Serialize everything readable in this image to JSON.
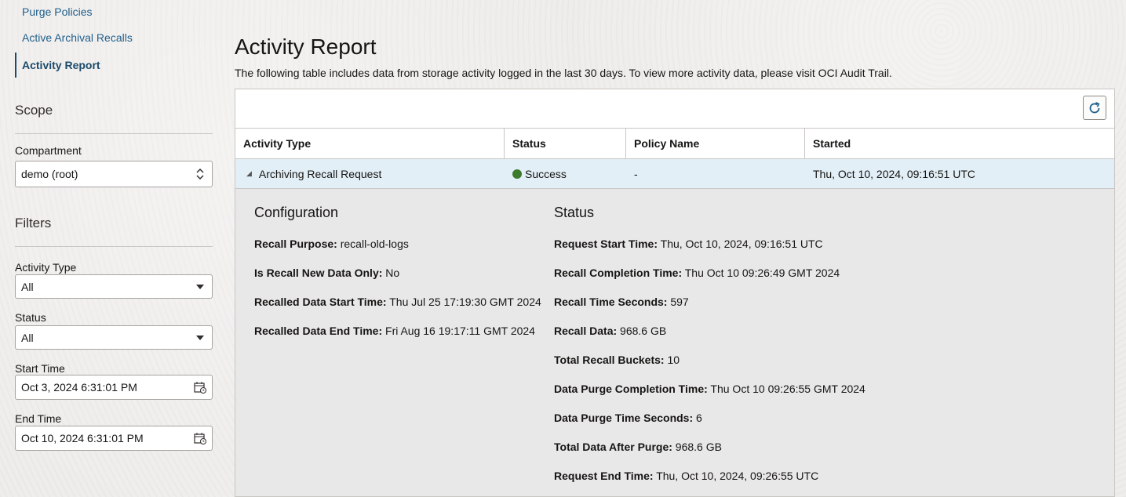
{
  "sidebar": {
    "nav": [
      {
        "label": "Purge Policies"
      },
      {
        "label": "Active Archival Recalls"
      },
      {
        "label": "Activity Report"
      }
    ],
    "scope_title": "Scope",
    "compartment": {
      "label": "Compartment",
      "value": "demo (root)"
    },
    "filters_title": "Filters",
    "activity_type": {
      "label": "Activity Type",
      "value": "All"
    },
    "status": {
      "label": "Status",
      "value": "All"
    },
    "start_time": {
      "label": "Start Time",
      "value": "Oct 3, 2024 6:31:01 PM"
    },
    "end_time": {
      "label": "End Time",
      "value": "Oct 10, 2024 6:31:01 PM"
    }
  },
  "main": {
    "title": "Activity Report",
    "description": "The following table includes data from storage activity logged in the last 30 days. To view more activity data, please visit OCI Audit Trail.",
    "columns": [
      "Activity Type",
      "Status",
      "Policy Name",
      "Started"
    ],
    "row": {
      "activity_type": "Archiving Recall Request",
      "status": "Success",
      "policy_name": "-",
      "started": "Thu, Oct 10, 2024, 09:16:51 UTC"
    },
    "status_color": "#3c7a2e",
    "detail": {
      "configuration_title": "Configuration",
      "configuration": [
        {
          "key": "Recall Purpose:",
          "value": "recall-old-logs"
        },
        {
          "key": "Is Recall New Data Only:",
          "value": "No"
        },
        {
          "key": "Recalled Data Start Time:",
          "value": "Thu Jul 25 17:19:30 GMT 2024"
        },
        {
          "key": "Recalled Data End Time:",
          "value": "Fri Aug 16 19:17:11 GMT 2024"
        }
      ],
      "status_title": "Status",
      "status": [
        {
          "key": "Request Start Time:",
          "value": "Thu, Oct 10, 2024, 09:16:51 UTC"
        },
        {
          "key": "Recall Completion Time:",
          "value": "Thu Oct 10 09:26:49 GMT 2024"
        },
        {
          "key": "Recall Time Seconds:",
          "value": "597"
        },
        {
          "key": "Recall Data:",
          "value": "968.6 GB"
        },
        {
          "key": "Total Recall Buckets:",
          "value": "10"
        },
        {
          "key": "Data Purge Completion Time:",
          "value": "Thu Oct 10 09:26:55 GMT 2024"
        },
        {
          "key": "Data Purge Time Seconds:",
          "value": "6"
        },
        {
          "key": "Total Data After Purge:",
          "value": "968.6 GB"
        },
        {
          "key": "Request End Time:",
          "value": "Thu, Oct 10, 2024, 09:26:55 UTC"
        }
      ]
    }
  }
}
